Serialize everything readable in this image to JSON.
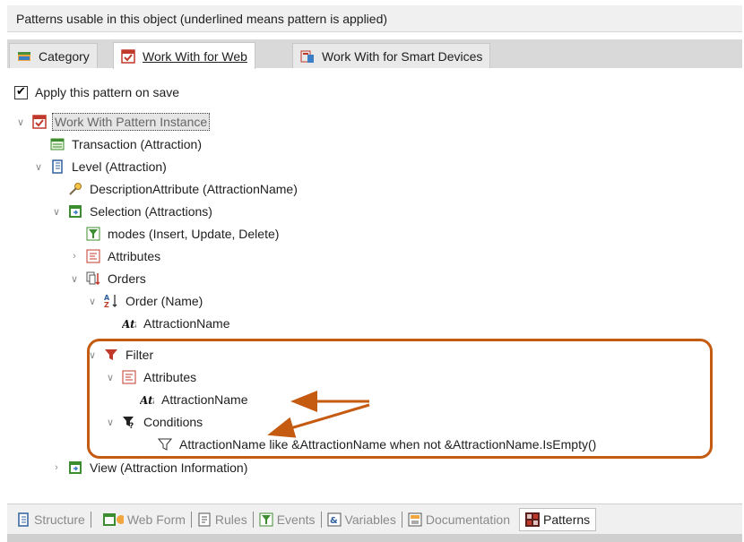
{
  "header": {
    "title": "Patterns usable in this object (underlined means pattern is applied)"
  },
  "tabs": [
    {
      "label": "Category",
      "icon": "category-icon",
      "active": false,
      "underlined": false
    },
    {
      "label": "Work With for Web",
      "icon": "work-with-web-icon",
      "active": true,
      "underlined": true
    },
    {
      "label": "Work With for Smart Devices",
      "icon": "smart-devices-icon",
      "active": false,
      "underlined": false
    }
  ],
  "apply_checkbox": {
    "label": "Apply this pattern on save",
    "checked": true
  },
  "tree": [
    {
      "label": "Work With Pattern Instance",
      "icon": "pattern-instance-icon",
      "expander": "expanded",
      "selected": true
    },
    {
      "label": "Transaction (Attraction)",
      "icon": "transaction-icon",
      "expander": "none"
    },
    {
      "label": "Level (Attraction)",
      "icon": "level-icon",
      "expander": "expanded"
    },
    {
      "label": "DescriptionAttribute (AttractionName)",
      "icon": "key-icon",
      "expander": "none"
    },
    {
      "label": "Selection (Attractions)",
      "icon": "selection-icon",
      "expander": "expanded"
    },
    {
      "label": "modes (Insert, Update, Delete)",
      "icon": "modes-icon",
      "expander": "none"
    },
    {
      "label": "Attributes",
      "icon": "attributes-icon",
      "expander": "collapsed"
    },
    {
      "label": "Orders",
      "icon": "orders-icon",
      "expander": "expanded"
    },
    {
      "label": "Order (Name)",
      "icon": "sort-az-icon",
      "expander": "expanded"
    },
    {
      "label": "AttractionName",
      "icon": "attribute-icon",
      "expander": "none"
    },
    {
      "label": "Filter",
      "icon": "filter-icon",
      "expander": "expanded"
    },
    {
      "label": "Attributes",
      "icon": "attributes-icon",
      "expander": "expanded"
    },
    {
      "label": "AttractionName",
      "icon": "attribute-icon",
      "expander": "none"
    },
    {
      "label": "Conditions",
      "icon": "conditions-icon",
      "expander": "expanded"
    },
    {
      "label": "AttractionName like &AttractionName when not &AttractionName.IsEmpty()",
      "icon": "condition-funnel-icon",
      "expander": "none"
    },
    {
      "label": "View (Attraction Information)",
      "icon": "view-icon",
      "expander": "collapsed"
    }
  ],
  "bottom_tabs": [
    {
      "label": "Structure",
      "icon": "structure-icon",
      "active": false
    },
    {
      "label": "Web Form",
      "icon": "web-form-icon",
      "active": false
    },
    {
      "label": "Rules",
      "icon": "rules-icon",
      "active": false
    },
    {
      "label": "Events",
      "icon": "events-icon",
      "active": false
    },
    {
      "label": "Variables",
      "icon": "variables-icon",
      "active": false
    },
    {
      "label": "Documentation",
      "icon": "documentation-icon",
      "active": false
    },
    {
      "label": "Patterns",
      "icon": "patterns-icon",
      "active": true
    }
  ],
  "colors": {
    "annotation": "#c55a11",
    "header_bg": "#f0f0f0",
    "tabstrip_bg": "#d9d9d9"
  }
}
